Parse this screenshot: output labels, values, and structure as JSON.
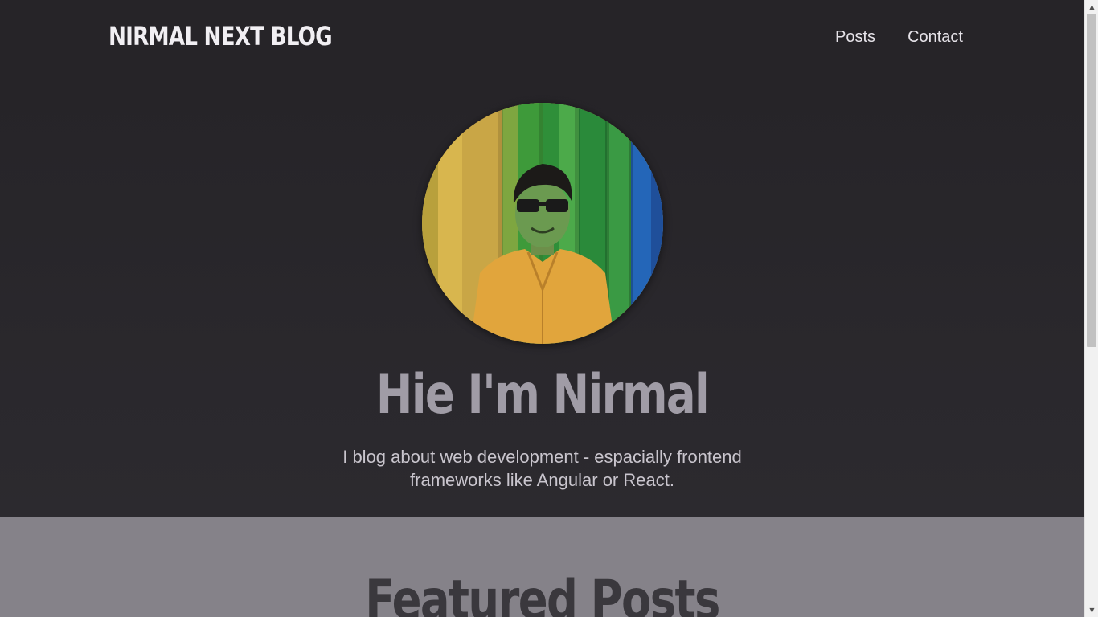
{
  "header": {
    "logo": "NIRMAL NEXT BLOG",
    "nav": [
      {
        "label": "Posts"
      },
      {
        "label": "Contact"
      }
    ]
  },
  "hero": {
    "title": "Hie I'm Nirmal",
    "text": "I blog about web development - espacially frontend frameworks like Angular or React."
  },
  "featured": {
    "title": "Featured Posts"
  },
  "colors": {
    "header_bg": "#262428",
    "hero_bg": "#2a282c",
    "featured_bg": "#858289",
    "title_color": "#a09ca6"
  },
  "icons": {
    "scroll_up": "▲",
    "scroll_down": "▼"
  }
}
